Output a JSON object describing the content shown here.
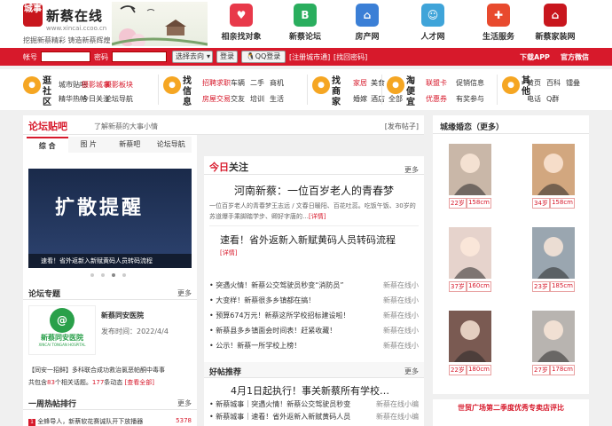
{
  "header": {
    "logo_text": "城事",
    "site_name": "新蔡在线",
    "site_url": "www.xincai.ccoo.cn",
    "slogan": "挖掘新蔡精彩 铸造新蔡辉煌",
    "nav": [
      {
        "label": "相亲找对象",
        "icon": "heart-icon",
        "color": "#e8394a"
      },
      {
        "label": "新蔡论坛",
        "icon": "bbs-icon",
        "color": "#2aae5e"
      },
      {
        "label": "房产网",
        "icon": "house-icon",
        "color": "#3b7fd6"
      },
      {
        "label": "人才网",
        "icon": "person-icon",
        "color": "#3fa4d9"
      },
      {
        "label": "生活服务",
        "icon": "cart-icon",
        "color": "#e84a2e"
      },
      {
        "label": "新蔡家装网",
        "icon": "home-decor-icon",
        "color": "#c8161d"
      }
    ]
  },
  "login": {
    "account_label": "帐号",
    "password_label": "密码",
    "select_value": "选择去向",
    "login_button": "登录",
    "qq_login": "QQ登录",
    "register": "[注册城市通]",
    "forgot": "[找回密码]",
    "download_app": "下载APP",
    "wechat": "官方微信"
  },
  "categories": [
    {
      "title": "逛社区",
      "icon": "community-icon",
      "links": [
        "城市贴吧",
        "摄影城事",
        "摄影板块",
        "精华热帖",
        "今日关注",
        "论坛导航"
      ],
      "red": [
        1,
        2
      ]
    },
    {
      "title": "找信息",
      "icon": "info-icon",
      "links": [
        "招聘求职",
        "车辆",
        "二手",
        "商机",
        "房屋交易",
        "交友",
        "培训",
        "生活"
      ],
      "red": [
        0,
        4
      ]
    },
    {
      "title": "找商家",
      "icon": "shop-icon",
      "links": [
        "家居",
        "美食",
        "汽车",
        "婚嫁",
        "酒店",
        "全部"
      ],
      "red": [
        0,
        2
      ]
    },
    {
      "title": "淘便宜",
      "icon": "cheap-icon",
      "links": [
        "联盟卡",
        "促销信息",
        "优惠券",
        "有奖参与"
      ],
      "red": [
        0,
        2
      ]
    },
    {
      "title": "其他",
      "icon": "other-icon",
      "links": [
        "黄页",
        "百科",
        "镭叠",
        "电话",
        "Q群"
      ],
      "red": []
    }
  ],
  "forum": {
    "title": "论坛贴吧",
    "subtitle": "了解新蔡的大事小情",
    "post_button": "[发布帖子]",
    "tabs": [
      "综 合",
      "图 片",
      "新蔡吧",
      "论坛导航"
    ],
    "slide_big": "扩散提醒",
    "slide_caption": "速看！省外返新入新赋黄码人员转码流程",
    "special": {
      "title": "论坛专题",
      "more": "更多",
      "name": "新蔡同安医院",
      "date": "发布时间：2022/4/4",
      "hospital_label": "新蔡同安医院",
      "hospital_en": "XINCAI TONGAN HOSPITAL",
      "desc1": "【同安一招鲜】多科联合成功救治氯恶帕酮中毒事",
      "desc2_a": "共包含",
      "count1": "83",
      "desc2_b": "个相关话题。",
      "count2": "177",
      "desc2_c": "条动态",
      "view_all": "[查看全部]"
    },
    "weekly": {
      "title": "一周热帖排行",
      "more": "更多",
      "first": "全蜂导人，新蔡软花赛诚队开下放播器",
      "first_num": "5378"
    }
  },
  "today": {
    "title_a": "今日",
    "title_b": "关注",
    "more": "更多",
    "headline": "河南新蔡：一位百岁老人的青春梦",
    "summary": "一位百岁老人的青春梦王志远 / 文春日暖阳、百花吐蕊。吃饭午饭、30岁的苏道爆手乘脚踏学步、卿好字唐的…",
    "detail": "[详情]",
    "headline2": "速看！省外返新入新赋黄码人员转码流程",
    "detail2": "[详情]",
    "list": [
      {
        "t": "突遇火情！新蔡公交驾驶员秒变“消防员”",
        "s": "新蔡在线小"
      },
      {
        "t": "大变样！新蔡很多乡镇都在搞！",
        "s": "新蔡在线小"
      },
      {
        "t": "预算674万元！新蔡这所学校招标建设啦！",
        "s": "新蔡在线小"
      },
      {
        "t": "新蔡县多乡镇面会时间表！赶紧收藏！",
        "s": "新蔡在线小"
      },
      {
        "t": "公示！新蔡一所学校上榜！",
        "s": "新蔡在线小"
      }
    ],
    "hot_title": "好帖推荐",
    "hot_more": "更多",
    "hot_headline": "4月1日起执行！事关新蔡所有学校…",
    "hot_list": [
      {
        "t": "新蔡城事｜突遇火情！新蔡公交驾驶员秒变",
        "s": "新蔡在线小编"
      },
      {
        "t": "新蔡城事｜速看！省外返新入新赋黄码人员",
        "s": "新蔡在线小编"
      }
    ]
  },
  "dating": {
    "title": "城缘婚恋（更多）",
    "people": [
      {
        "age": "22岁",
        "height": "158cm",
        "bg": "#c9b7a8"
      },
      {
        "age": "34岁",
        "height": "158cm",
        "bg": "#d2a77f"
      },
      {
        "age": "37岁",
        "height": "160cm",
        "bg": "#e6d3cc"
      },
      {
        "age": "23岁",
        "height": "185cm",
        "bg": "#9aa6b0"
      },
      {
        "age": "22岁",
        "height": "180cm",
        "bg": "#7a5a52"
      },
      {
        "age": "27岁",
        "height": "178cm",
        "bg": "#b8b4b0"
      }
    ],
    "bottom_banner": "世贸广场第二季度优秀专卖店评比"
  }
}
